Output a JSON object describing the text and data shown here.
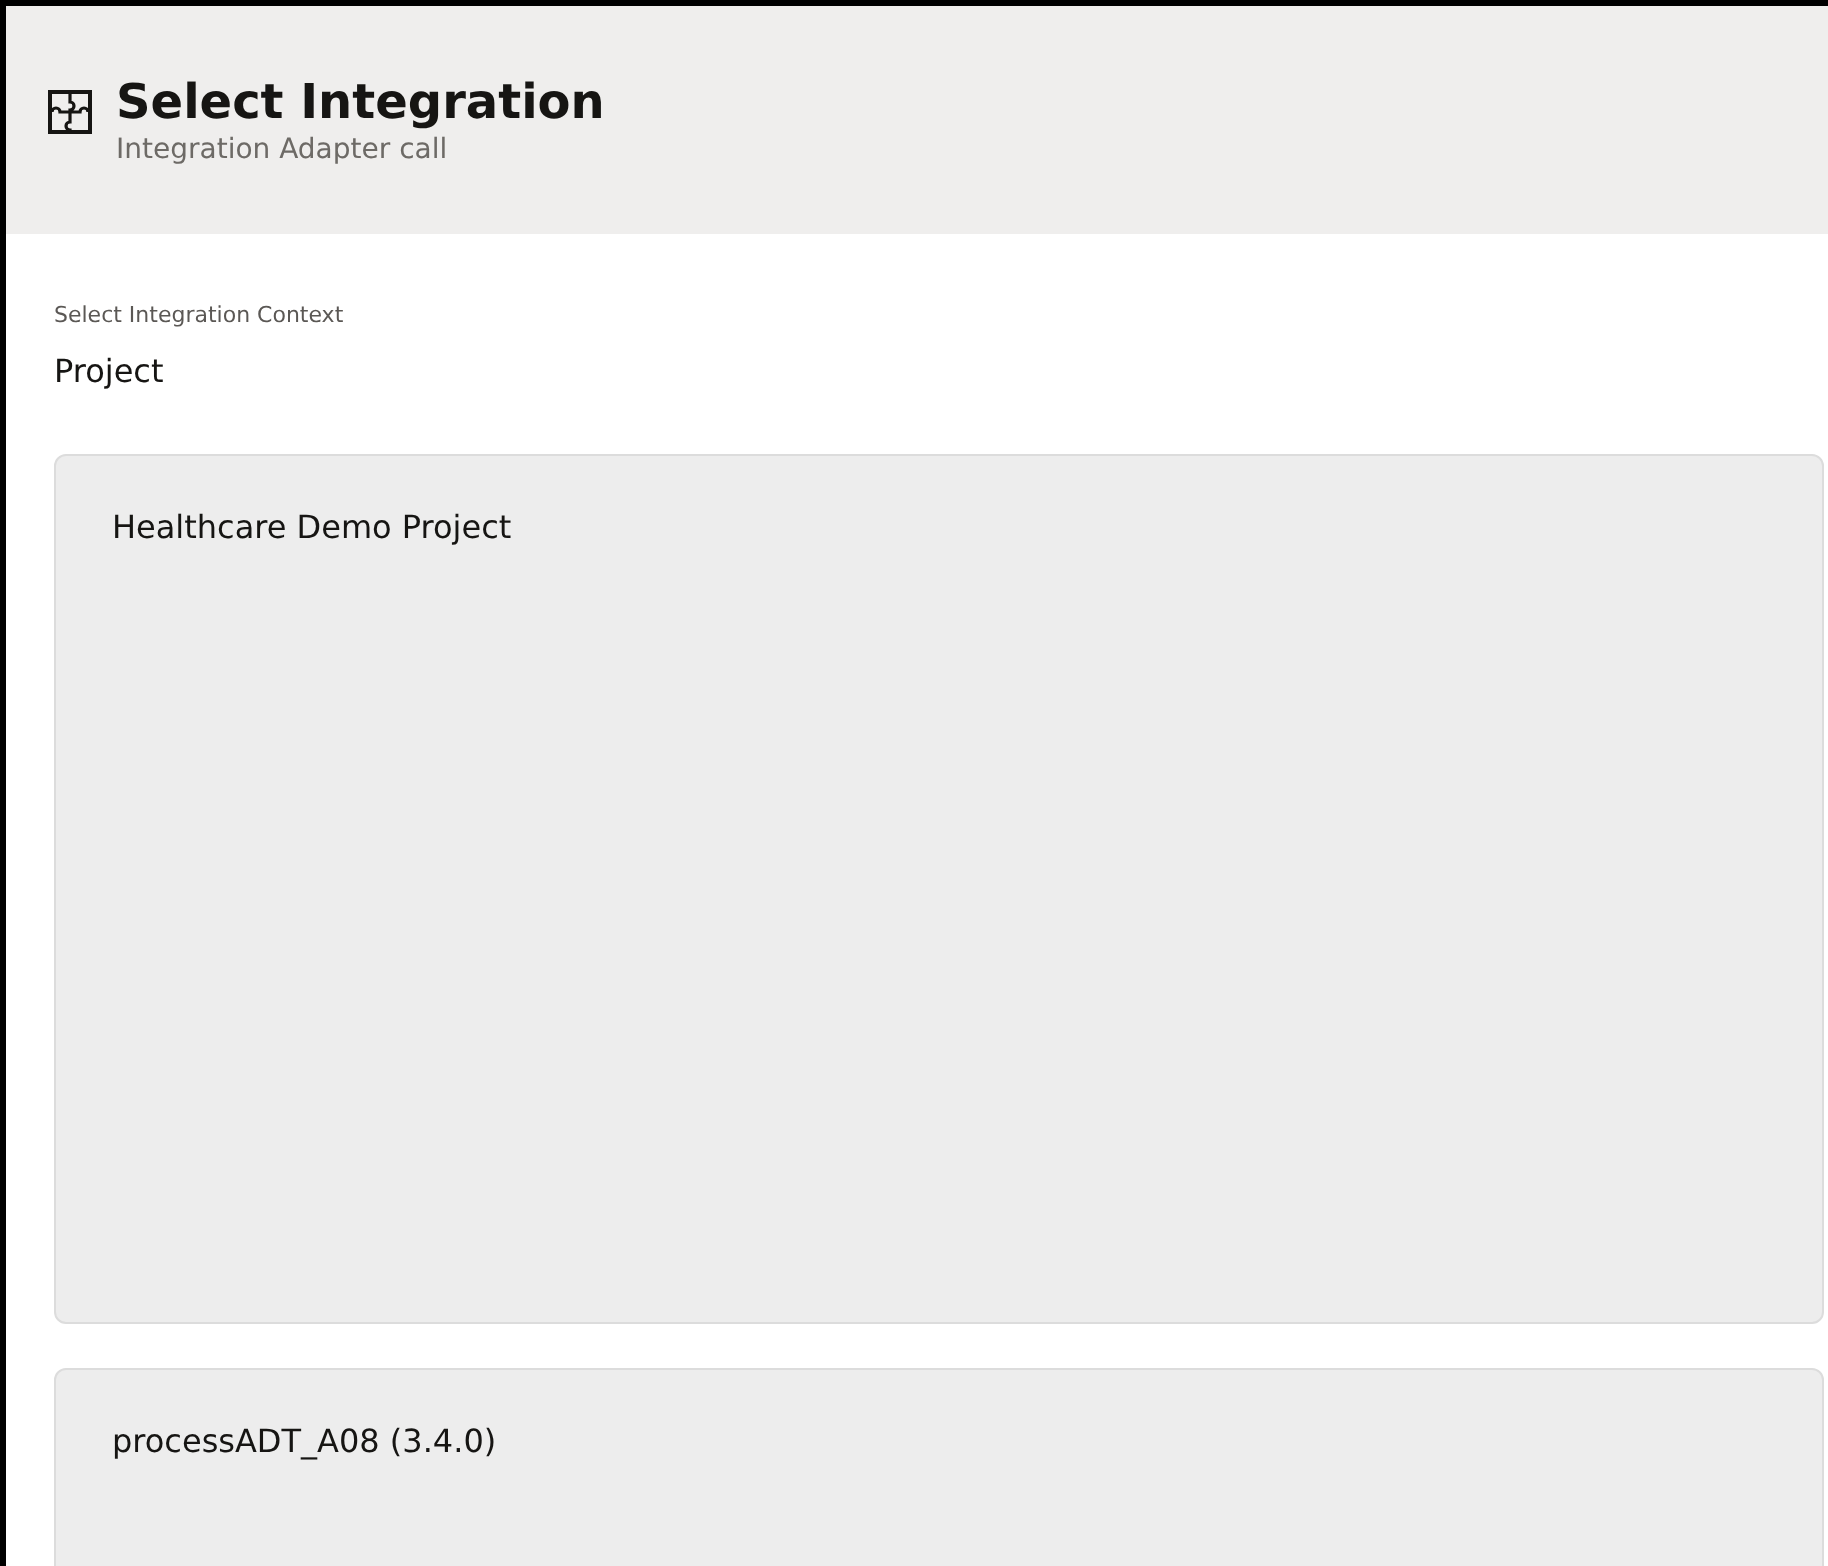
{
  "header": {
    "title": "Select Integration",
    "subtitle": "Integration Adapter call"
  },
  "context": {
    "label": "Select Integration Context",
    "value": "Project"
  },
  "cards": [
    {
      "name": "Healthcare Demo Project",
      "kind": "tall"
    },
    {
      "name": "processADT_A08 (3.4.0)",
      "kind": "short"
    }
  ]
}
